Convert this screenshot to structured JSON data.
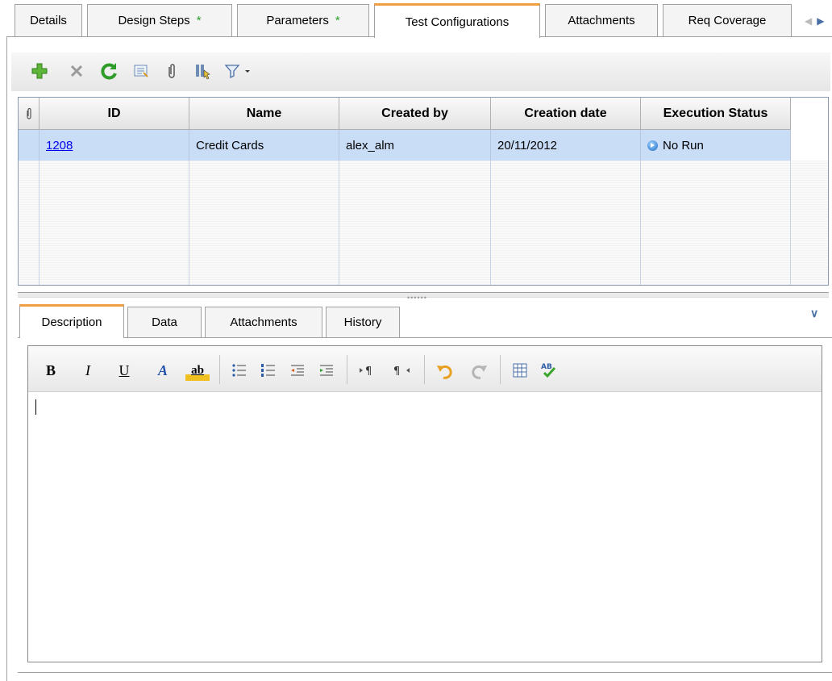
{
  "top_tabs": [
    {
      "label": "Details"
    },
    {
      "label": "Design Steps",
      "modified": "*"
    },
    {
      "label": "Parameters",
      "modified": "*"
    },
    {
      "label": "Test Configurations"
    },
    {
      "label": "Attachments"
    },
    {
      "label": "Req Coverage"
    }
  ],
  "grid": {
    "columns": [
      "ID",
      "Name",
      "Created by",
      "Creation date",
      "Execution Status"
    ],
    "rows": [
      {
        "id": "1208",
        "name": "Credit Cards",
        "created_by": "alex_alm",
        "creation_date": "20/11/2012",
        "execution_status": "No Run"
      }
    ]
  },
  "bottom_tabs": [
    {
      "label": "Description"
    },
    {
      "label": "Data"
    },
    {
      "label": "Attachments"
    },
    {
      "label": "History"
    }
  ],
  "editor": {
    "bold": "B",
    "italic": "I",
    "underline": "U",
    "font_color": "A",
    "highlight": "ab"
  },
  "icons": {
    "add": "plus-icon",
    "delete": "x-icon",
    "refresh": "refresh-icon",
    "details": "form-icon",
    "attach": "paperclip-icon",
    "columns": "columns-icon",
    "filter": "funnel-icon"
  },
  "colors": {
    "accent_tab": "#f0a040",
    "selected_row": "#c9ddf7",
    "star": "#2aa12a",
    "link": "#0000ee"
  }
}
